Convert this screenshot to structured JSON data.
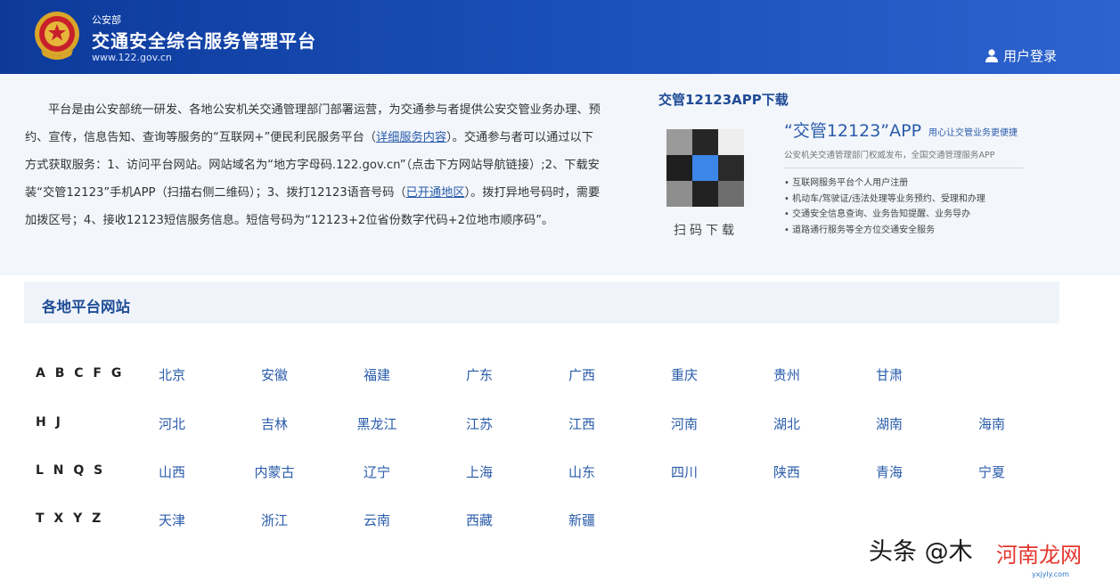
{
  "header": {
    "ministry": "公安部",
    "title": "交通安全综合服务管理平台",
    "url": "www.122.gov.cn",
    "login_label": "用户登录",
    "colors": {
      "bg": "#1a4fb8",
      "text": "#ffffff"
    }
  },
  "intro": {
    "p1": "平台是由公安部统一研发、各地公安机关交通管理部门部署运营，为交通参与者提供公安交管业务办理、预约、宣传，信息告知、查询等服务的“互联网+”便民利民服务平台（",
    "link1": "详细服务内容",
    "p2": "）。交通参与者可以通过以下方式获取服务：1、访问平台网站。网站域名为“地方字母码.122.gov.cn”（点击下方网站导航链接）;2、下载安装“交管12123”手机APP（扫描右侧二维码）；3、拨打12123语音号码（",
    "link2": "已开通地区",
    "p3": "）。拨打异地号码时，需要加拨区号；4、接收12123短信服务信息。短信号码为“12123+2位省份数字代码+2位地市顺序码”。"
  },
  "app": {
    "section_title": "交管12123APP下载",
    "scan_label": "扫码下载",
    "name": "“交管12123”APP",
    "slogan": "用心让交管业务更便捷",
    "desc": "公安机关交通管理部门权威发布，全国交通管理服务APP",
    "features": [
      "互联网服务平台个人用户注册",
      "机动车/驾驶证/违法处理等业务预约、受理和办理",
      "交通安全信息查询、业务告知提醒、业务导办",
      "道路通行服务等全方位交通安全服务"
    ]
  },
  "regions": {
    "title": "各地平台网站",
    "rows": [
      {
        "label": "A B C F G",
        "cities": [
          "北京",
          "安徽",
          "福建",
          "广东",
          "广西",
          "重庆",
          "贵州",
          "甘肃"
        ]
      },
      {
        "label": "H J",
        "cities": [
          "河北",
          "吉林",
          "黑龙江",
          "江苏",
          "江西",
          "河南",
          "湖北",
          "湖南",
          "海南"
        ]
      },
      {
        "label": "L N Q S",
        "cities": [
          "山西",
          "内蒙古",
          "辽宁",
          "上海",
          "山东",
          "四川",
          "陕西",
          "青海",
          "宁夏"
        ]
      },
      {
        "label": "T X Y Z",
        "cities": [
          "天津",
          "浙江",
          "云南",
          "西藏",
          "新疆"
        ]
      }
    ]
  },
  "watermark": {
    "text": "头条 @木",
    "site": "河南龙网",
    "url": "yxjyly.com"
  }
}
